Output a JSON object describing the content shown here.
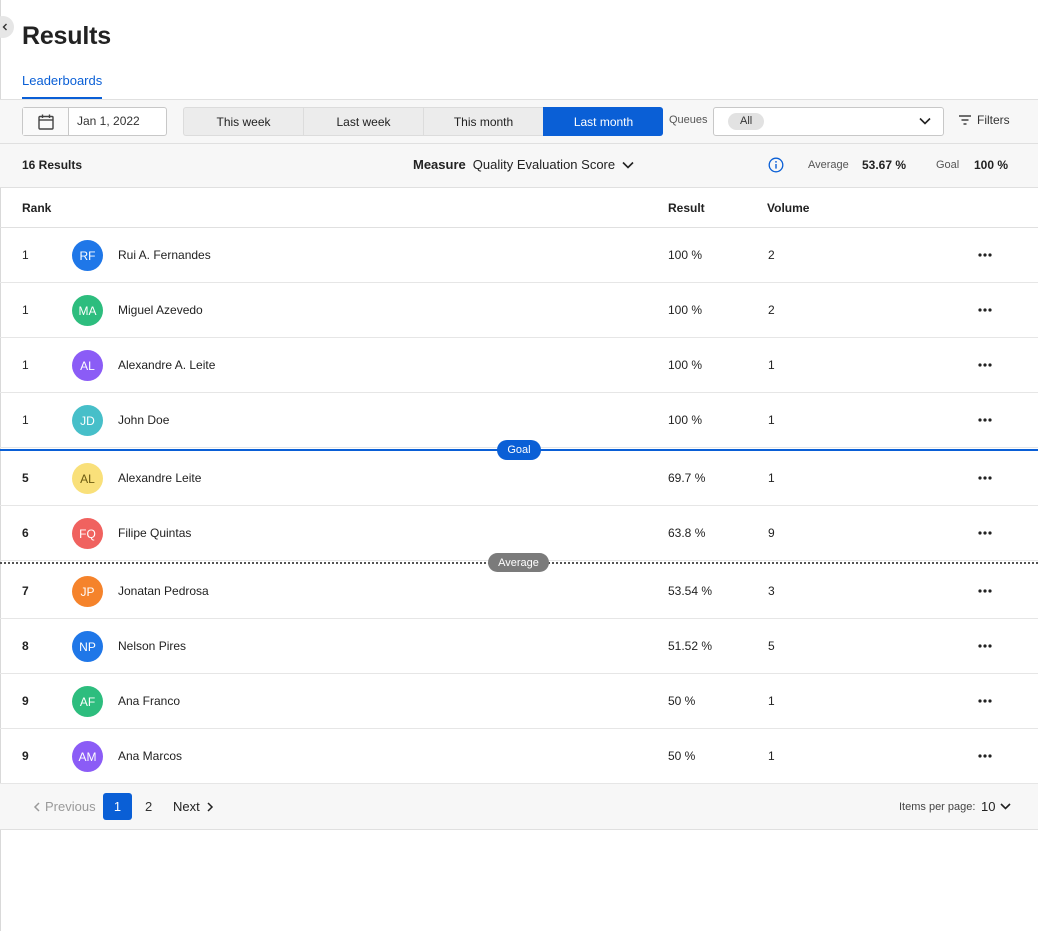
{
  "page": {
    "title": "Results"
  },
  "tabs": [
    {
      "label": "Leaderboards"
    }
  ],
  "toolbar": {
    "date": "Jan 1, 2022",
    "periods": [
      "This week",
      "Last week",
      "This month",
      "Last month"
    ],
    "active_period": "Last month",
    "queues_label": "Queues",
    "queue_value": "All",
    "filters_label": "Filters"
  },
  "summary": {
    "results_count": "16 Results",
    "measure_label": "Measure",
    "measure_value": "Quality Evaluation Score",
    "average_label": "Average",
    "average_value": "53.67 %",
    "goal_label": "Goal",
    "goal_value": "100 %"
  },
  "table": {
    "columns": {
      "rank": "Rank",
      "result": "Result",
      "volume": "Volume"
    },
    "rows": [
      {
        "rank": "1",
        "initials": "RF",
        "name": "Rui A. Fernandes",
        "result": "100 %",
        "volume": "2",
        "avatar_color": "#1f77e8"
      },
      {
        "rank": "1",
        "initials": "MA",
        "name": "Miguel Azevedo",
        "result": "100 %",
        "volume": "2",
        "avatar_color": "#2dbd7e"
      },
      {
        "rank": "1",
        "initials": "AL",
        "name": "Alexandre A. Leite",
        "result": "100 %",
        "volume": "1",
        "avatar_color": "#8b5cf6"
      },
      {
        "rank": "1",
        "initials": "JD",
        "name": "John Doe",
        "result": "100 %",
        "volume": "1",
        "avatar_color": "#47bfc9"
      },
      {
        "rank": "5",
        "initials": "AL",
        "name": "Alexandre Leite",
        "result": "69.7 %",
        "volume": "1",
        "avatar_color": "#f9e07a"
      },
      {
        "rank": "6",
        "initials": "FQ",
        "name": "Filipe Quintas",
        "result": "63.8 %",
        "volume": "9",
        "avatar_color": "#f0625f"
      },
      {
        "rank": "7",
        "initials": "JP",
        "name": "Jonatan Pedrosa",
        "result": "53.54 %",
        "volume": "3",
        "avatar_color": "#f5832b"
      },
      {
        "rank": "8",
        "initials": "NP",
        "name": "Nelson Pires",
        "result": "51.52 %",
        "volume": "5",
        "avatar_color": "#1f77e8"
      },
      {
        "rank": "9",
        "initials": "AF",
        "name": "Ana Franco",
        "result": "50 %",
        "volume": "1",
        "avatar_color": "#2dbd7e"
      },
      {
        "rank": "9",
        "initials": "AM",
        "name": "Ana Marcos",
        "result": "50 %",
        "volume": "1",
        "avatar_color": "#8b5cf6"
      }
    ]
  },
  "markers": {
    "goal": "Goal",
    "average": "Average"
  },
  "pagination": {
    "previous": "Previous",
    "pages": [
      "1",
      "2"
    ],
    "current": "1",
    "next": "Next",
    "items_per_page_label": "Items per page:",
    "items_per_page": "10"
  },
  "colors": {
    "accent": "#0a5fd6"
  }
}
